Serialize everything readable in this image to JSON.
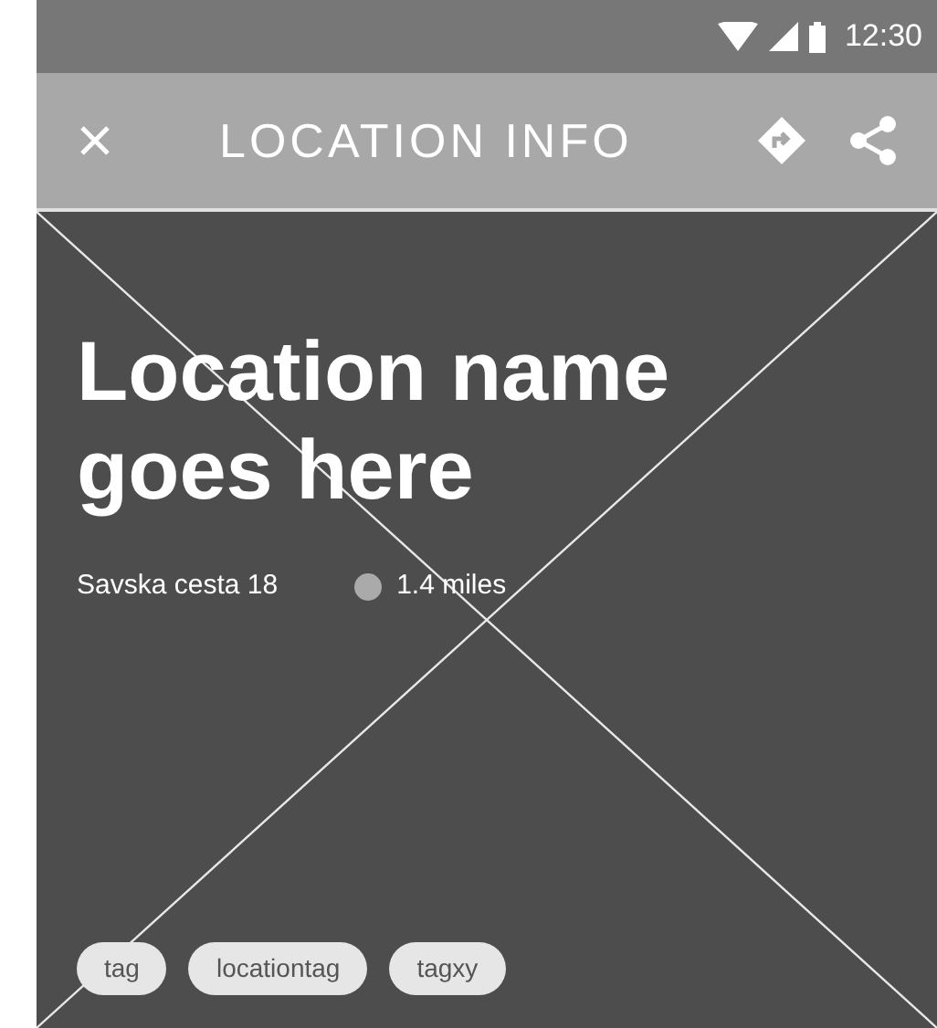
{
  "status_bar": {
    "time": "12:30"
  },
  "app_bar": {
    "title": "LOCATION INFO"
  },
  "location": {
    "name": "Location name goes here",
    "address": "Savska cesta 18",
    "distance": "1.4 miles"
  },
  "tags": [
    "tag",
    "locationtag",
    "tagxy"
  ]
}
